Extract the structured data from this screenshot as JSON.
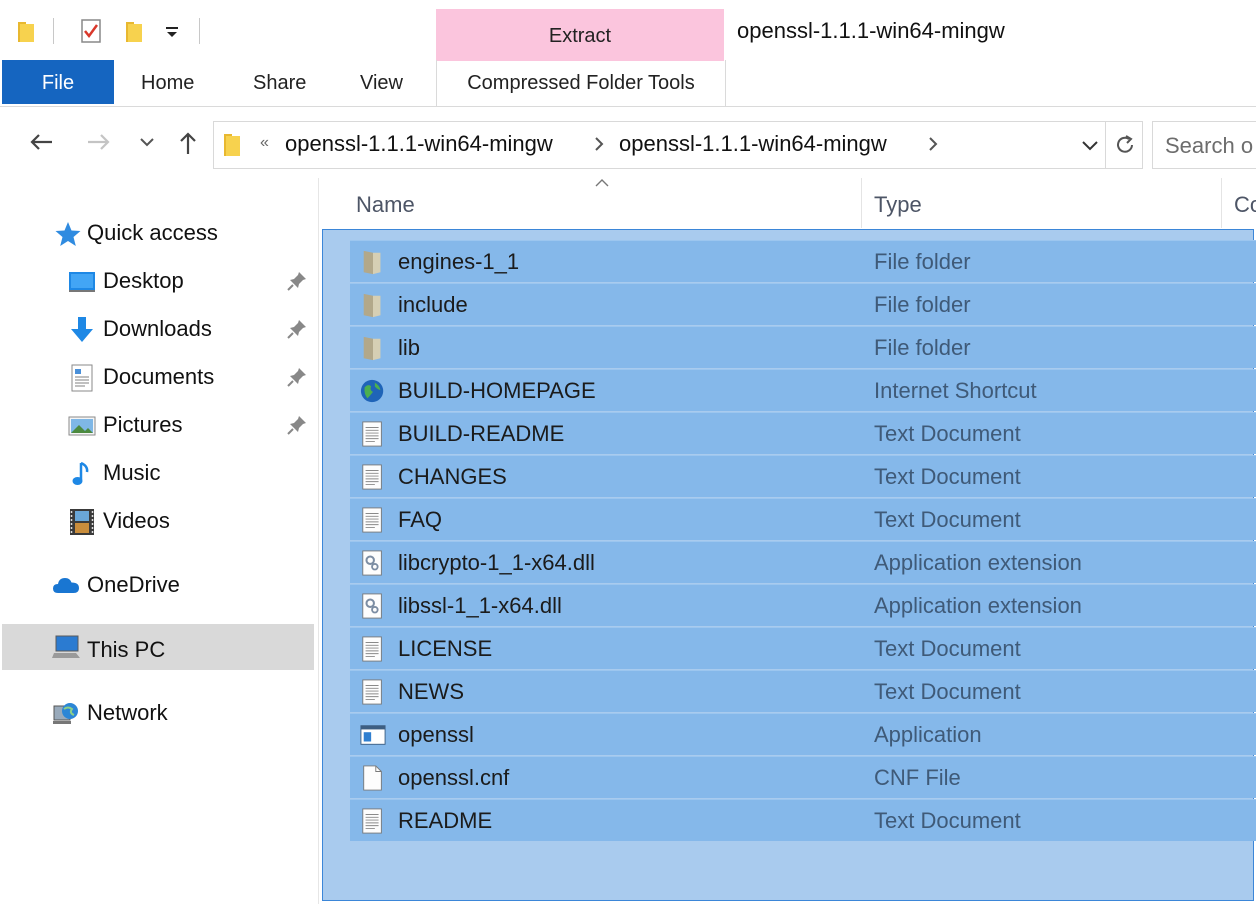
{
  "window": {
    "title": "openssl-1.1.1-win64-mingw",
    "contextual_tab": "Extract",
    "contextual_group": "Compressed Folder Tools"
  },
  "ribbon": {
    "tabs": [
      "File",
      "Home",
      "Share",
      "View"
    ]
  },
  "address_bar": {
    "overflow_marker": "«",
    "crumbs": [
      "openssl-1.1.1-win64-mingw",
      "openssl-1.1.1-win64-mingw"
    ],
    "search_placeholder": "Search o"
  },
  "nav_pane": {
    "items": [
      {
        "label": "Quick access",
        "icon": "star-icon"
      },
      {
        "label": "Desktop",
        "icon": "desktop-icon",
        "pinned": true
      },
      {
        "label": "Downloads",
        "icon": "download-arrow-icon",
        "pinned": true
      },
      {
        "label": "Documents",
        "icon": "documents-icon",
        "pinned": true
      },
      {
        "label": "Pictures",
        "icon": "pictures-icon",
        "pinned": true
      },
      {
        "label": "Music",
        "icon": "music-note-icon"
      },
      {
        "label": "Videos",
        "icon": "film-strip-icon"
      },
      {
        "label": "OneDrive",
        "icon": "cloud-icon"
      },
      {
        "label": "This PC",
        "icon": "computer-icon",
        "selected": true
      },
      {
        "label": "Network",
        "icon": "network-globe-icon"
      }
    ]
  },
  "columns": {
    "name": "Name",
    "type": "Type",
    "third": "Co"
  },
  "files": [
    {
      "name": "engines-1_1",
      "type": "File folder",
      "icon": "folder-icon"
    },
    {
      "name": "include",
      "type": "File folder",
      "icon": "folder-icon"
    },
    {
      "name": "lib",
      "type": "File folder",
      "icon": "folder-icon"
    },
    {
      "name": "BUILD-HOMEPAGE",
      "type": "Internet Shortcut",
      "icon": "globe-icon"
    },
    {
      "name": "BUILD-README",
      "type": "Text Document",
      "icon": "text-doc-icon"
    },
    {
      "name": "CHANGES",
      "type": "Text Document",
      "icon": "text-doc-icon"
    },
    {
      "name": "FAQ",
      "type": "Text Document",
      "icon": "text-doc-icon"
    },
    {
      "name": "libcrypto-1_1-x64.dll",
      "type": "Application extension",
      "icon": "dll-gear-icon"
    },
    {
      "name": "libssl-1_1-x64.dll",
      "type": "Application extension",
      "icon": "dll-gear-icon"
    },
    {
      "name": "LICENSE",
      "type": "Text Document",
      "icon": "text-doc-icon"
    },
    {
      "name": "NEWS",
      "type": "Text Document",
      "icon": "text-doc-icon"
    },
    {
      "name": "openssl",
      "type": "Application",
      "icon": "application-window-icon"
    },
    {
      "name": "openssl.cnf",
      "type": "CNF File",
      "icon": "blank-file-icon"
    },
    {
      "name": "README",
      "type": "Text Document",
      "icon": "text-doc-icon"
    }
  ],
  "colors": {
    "file_tab": "#1565c0",
    "extract_tab": "#fbc5dd",
    "selected_row": "#85b8ea",
    "selection_rect": "#a9cbee"
  }
}
